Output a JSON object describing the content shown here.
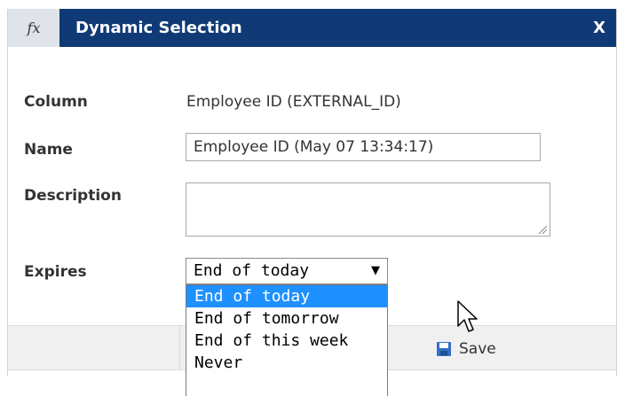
{
  "titlebar": {
    "fx_icon": "fx",
    "title": "Dynamic Selection",
    "close": "X"
  },
  "form": {
    "column_label": "Column",
    "column_value": "Employee ID (EXTERNAL_ID)",
    "name_label": "Name",
    "name_value": "Employee ID (May 07 13:34:17)",
    "description_label": "Description",
    "description_value": "",
    "expires_label": "Expires",
    "expires_selected": "End of today",
    "expires_options": [
      "End of today",
      "End of tomorrow",
      "End of this week",
      "Never"
    ]
  },
  "footer": {
    "save_label": "Save"
  },
  "colors": {
    "titlebar": "#0f3a75",
    "highlight": "#1e90ff"
  }
}
